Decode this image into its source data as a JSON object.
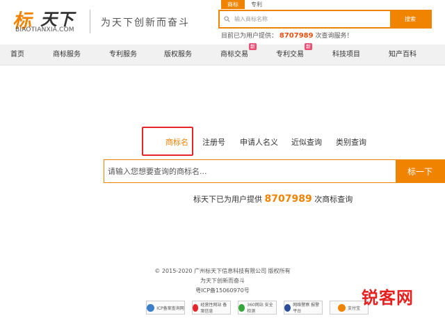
{
  "header": {
    "logo_mark": "标",
    "logo_cn": "天下",
    "logo_url": "BIAOTIANXIA.COM",
    "slogan": "为天下创新而奋斗",
    "search_tabs": [
      {
        "label": "商标",
        "active": true
      },
      {
        "label": "专利",
        "active": false
      }
    ],
    "search_placeholder": "输入商标名称",
    "search_button": "搜索",
    "provided_prefix": "目前已为用户提供：",
    "provided_number": "8707989",
    "provided_suffix": "次查询服务！"
  },
  "nav": {
    "items": [
      {
        "label": "首页"
      },
      {
        "label": "商标服务"
      },
      {
        "label": "专利服务"
      },
      {
        "label": "版权服务"
      },
      {
        "label": "商标交易",
        "badge": "新"
      },
      {
        "label": "专利交易",
        "badge": "新"
      },
      {
        "label": "科技项目"
      },
      {
        "label": "知产百科"
      }
    ]
  },
  "main": {
    "tabs": [
      {
        "label": "商标名",
        "active": true
      },
      {
        "label": "注册号"
      },
      {
        "label": "申请人名义"
      },
      {
        "label": "近似查询"
      },
      {
        "label": "类别查询"
      }
    ],
    "input_placeholder": "请输入您想要查询的商标名...",
    "search_button": "标一下",
    "stat_prefix": "标天下已为用户提供",
    "stat_number": "8707989",
    "stat_suffix": "次商标查询"
  },
  "footer": {
    "copyright": "© 2015-2020 广州标天下信息科技有限公司 版权所有",
    "slogan": "为天下创新而奋斗",
    "icp": "粤ICP备15060970号",
    "badges": [
      {
        "label": "ICP备案查询网",
        "color": "#3d7ec8"
      },
      {
        "label": "经营性网站 备案信息",
        "color": "#e4262a"
      },
      {
        "label": "360网站 安全检测",
        "color": "#38a73b"
      },
      {
        "label": "网络警察 报警平台",
        "color": "#2d4e9a"
      },
      {
        "label": "支付宝",
        "color": "#f08300"
      }
    ]
  },
  "watermark": {
    "text": "锐客网"
  },
  "colors": {
    "accent": "#f08300",
    "highlight_border": "#e4262a",
    "nav_bg": "#f1f1f1",
    "badge_new": "#e94e74"
  }
}
